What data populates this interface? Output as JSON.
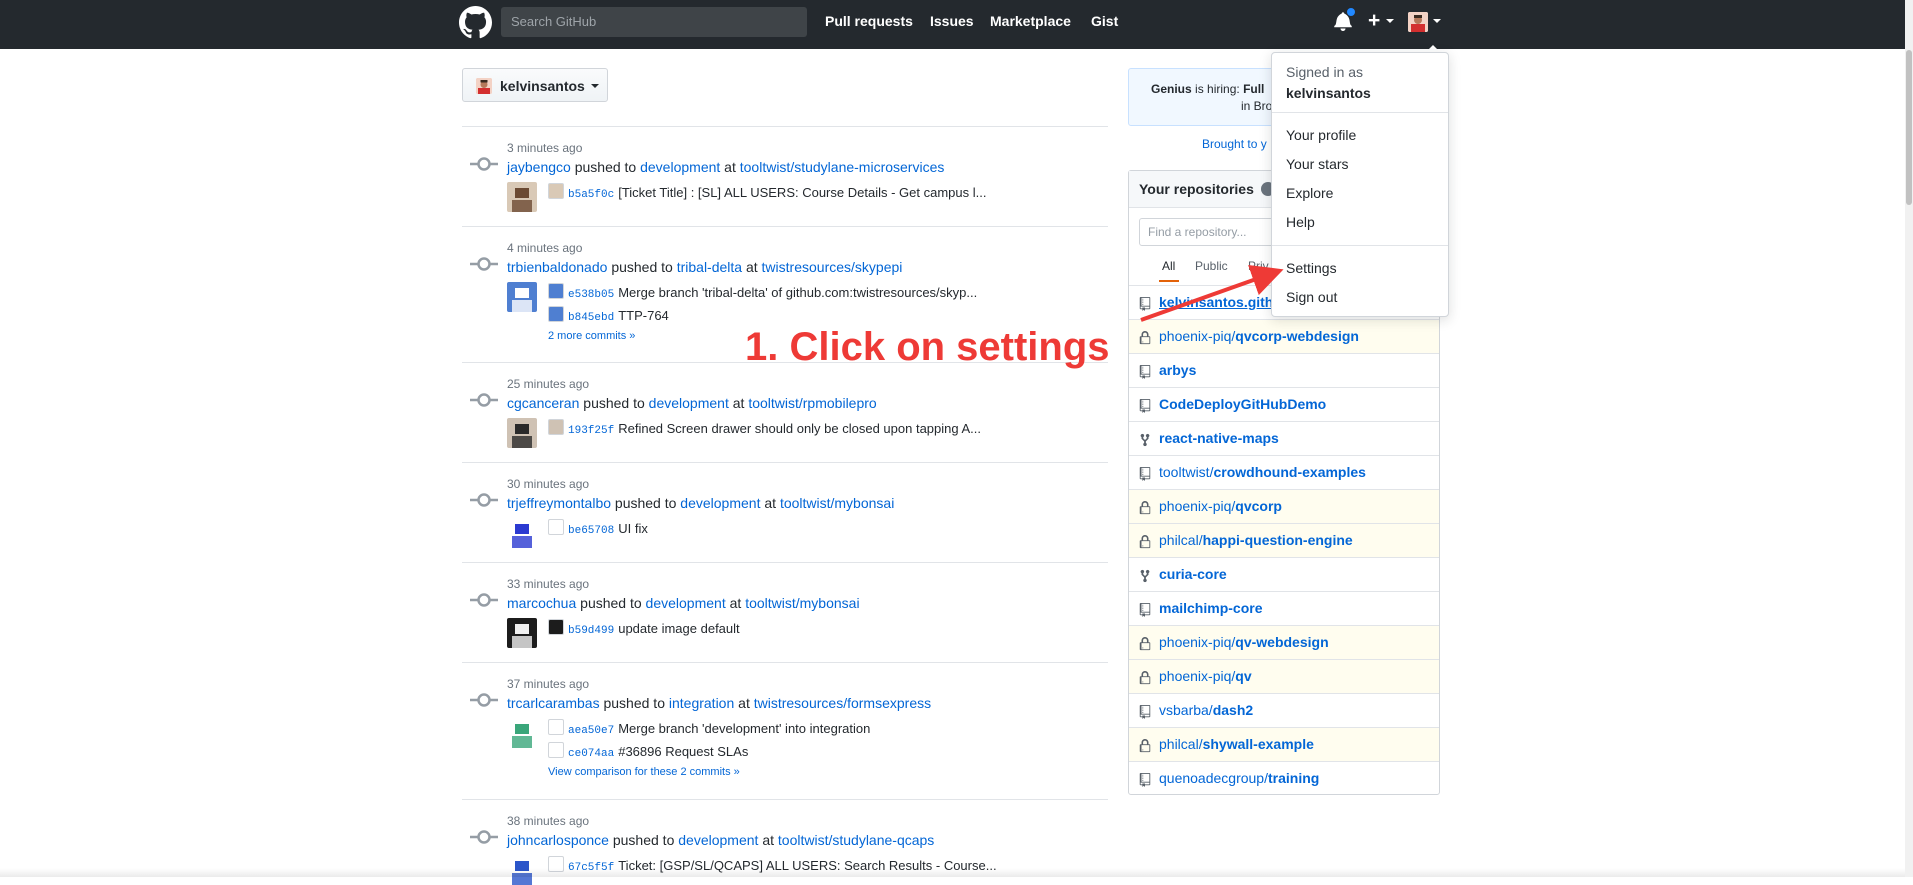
{
  "header": {
    "search_placeholder": "Search GitHub",
    "nav": [
      "Pull requests",
      "Issues",
      "Marketplace",
      "Gist"
    ],
    "plus": "+"
  },
  "context": {
    "username": "kelvinsantos"
  },
  "feed": [
    {
      "time": "3 minutes ago",
      "user": "jaybengco",
      "action": "pushed to",
      "branch": "development",
      "at": "at",
      "repo": "tooltwist/studylane-microservices",
      "commits": [
        {
          "sha": "b5a5f0c",
          "message": "[Ticket Title] : [SL] ALL USERS: Course Details - Get campus l..."
        }
      ]
    },
    {
      "time": "4 minutes ago",
      "user": "trbienbaldonado",
      "action": "pushed to",
      "branch": "tribal-delta",
      "at": "at",
      "repo": "twistresources/skypepi",
      "commits": [
        {
          "sha": "e538b05",
          "message": "Merge branch 'tribal-delta' of github.com:twistresources/skyp..."
        },
        {
          "sha": "b845ebd",
          "message": "TTP-764"
        }
      ],
      "more": "2 more commits »"
    },
    {
      "time": "25 minutes ago",
      "user": "cgcanceran",
      "action": "pushed to",
      "branch": "development",
      "at": "at",
      "repo": "tooltwist/rpmobilepro",
      "commits": [
        {
          "sha": "193f25f",
          "message": "Refined Screen drawer should only be closed upon tapping A..."
        }
      ]
    },
    {
      "time": "30 minutes ago",
      "user": "trjeffreymontalbo",
      "action": "pushed to",
      "branch": "development",
      "at": "at",
      "repo": "tooltwist/mybonsai",
      "commits": [
        {
          "sha": "be65708",
          "message": "UI fix"
        }
      ]
    },
    {
      "time": "33 minutes ago",
      "user": "marcochua",
      "action": "pushed to",
      "branch": "development",
      "at": "at",
      "repo": "tooltwist/mybonsai",
      "commits": [
        {
          "sha": "b59d499",
          "message": "update image default"
        }
      ]
    },
    {
      "time": "37 minutes ago",
      "user": "trcarlcarambas",
      "action": "pushed to",
      "branch": "integration",
      "at": "at",
      "repo": "twistresources/formsexpress",
      "commits": [
        {
          "sha": "aea50e7",
          "message": "Merge branch 'development' into integration"
        },
        {
          "sha": "ce074aa",
          "message": "#36896 Request SLAs"
        }
      ],
      "more": "View comparison for these 2 commits »"
    },
    {
      "time": "38 minutes ago",
      "user": "johncarlosponce",
      "action": "pushed to",
      "branch": "development",
      "at": "at",
      "repo": "tooltwist/studylane-qcaps",
      "commits": [
        {
          "sha": "67c5f5f",
          "message": "Ticket: [GSP/SL/QCAPS] ALL USERS: Search Results - Course..."
        }
      ]
    }
  ],
  "promo": {
    "company": "Genius",
    "text": "is hiring:",
    "role": "Full",
    "line2": "in Broo",
    "brought": "Brought to y"
  },
  "repos": {
    "title": "Your repositories",
    "filter_placeholder": "Find a repository...",
    "tabs": [
      "All",
      "Public",
      "Priv"
    ],
    "items": [
      {
        "owner": "kelvinsantos.gith",
        "name": "",
        "type": "public"
      },
      {
        "owner": "phoenix-piq/",
        "name": "qvcorp-webdesign",
        "type": "private"
      },
      {
        "owner": "",
        "name": "arbys",
        "type": "public"
      },
      {
        "owner": "",
        "name": "CodeDeployGitHubDemo",
        "type": "public"
      },
      {
        "owner": "",
        "name": "react-native-maps",
        "type": "fork"
      },
      {
        "owner": "tooltwist/",
        "name": "crowdhound-examples",
        "type": "public"
      },
      {
        "owner": "phoenix-piq/",
        "name": "qvcorp",
        "type": "private"
      },
      {
        "owner": "philcal/",
        "name": "happi-question-engine",
        "type": "private"
      },
      {
        "owner": "",
        "name": "curia-core",
        "type": "fork"
      },
      {
        "owner": "",
        "name": "mailchimp-core",
        "type": "public"
      },
      {
        "owner": "phoenix-piq/",
        "name": "qv-webdesign",
        "type": "private"
      },
      {
        "owner": "phoenix-piq/",
        "name": "qv",
        "type": "private"
      },
      {
        "owner": "vsbarba/",
        "name": "dash2",
        "type": "public"
      },
      {
        "owner": "philcal/",
        "name": "shywall-example",
        "type": "private"
      },
      {
        "owner": "quenoadecgroup/",
        "name": "training",
        "type": "public"
      }
    ]
  },
  "dropdown": {
    "signed_in_as": "Signed in as",
    "username": "kelvinsantos",
    "items": [
      "Your profile",
      "Your stars",
      "Explore",
      "Help",
      "Settings",
      "Sign out"
    ]
  },
  "annotation": {
    "text": "1. Click on settings",
    "color": "#ee3a36"
  },
  "colors": {
    "header_bg": "#24292e",
    "link": "#0366d6",
    "private_row": "#fffdef"
  }
}
